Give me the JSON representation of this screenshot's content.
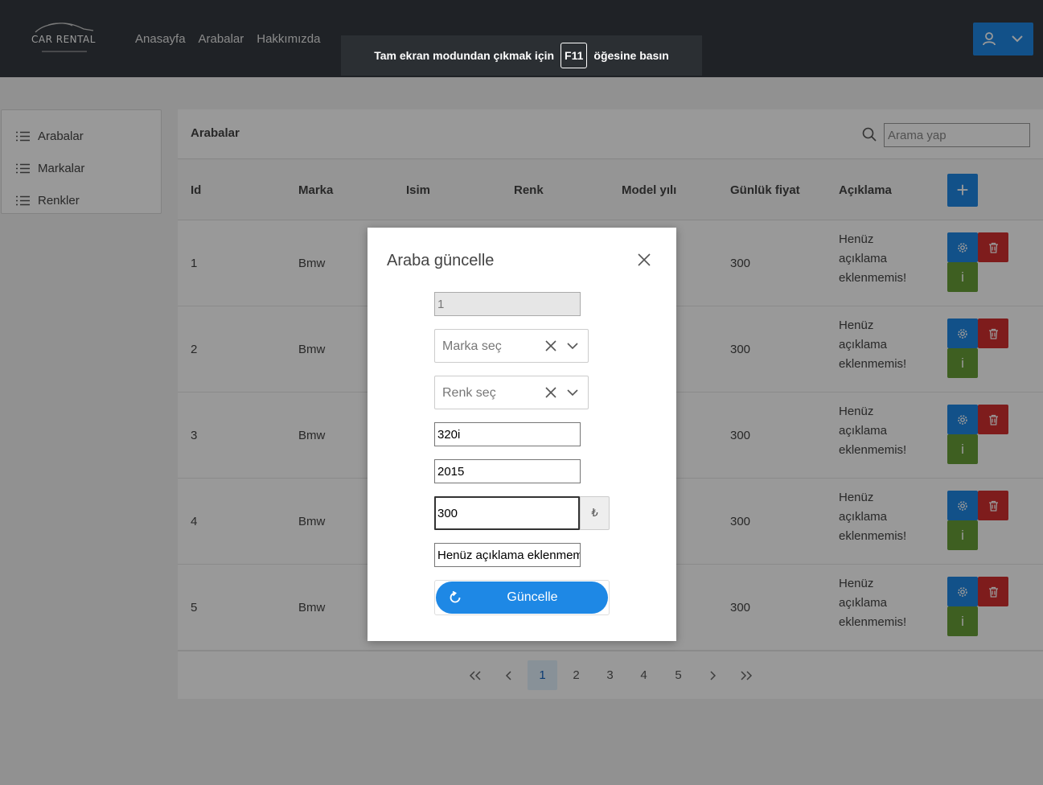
{
  "brand": {
    "logo_text": "CAR RENTAL"
  },
  "nav": {
    "items": [
      "Anasayfa",
      "Arabalar",
      "Hakkımızda"
    ]
  },
  "fullscreen_banner": {
    "before": "Tam ekran modundan çıkmak için",
    "key": "F11",
    "after": "öğesine basın"
  },
  "sidebar": {
    "items": [
      "Arabalar",
      "Markalar",
      "Renkler"
    ]
  },
  "table": {
    "title": "Arabalar",
    "search_placeholder": "Arama yap",
    "add_label": "+",
    "columns": [
      "Id",
      "Marka",
      "Isim",
      "Renk",
      "Model yılı",
      "Günlük fiyat",
      "Açıklama"
    ],
    "rows": [
      {
        "id": "1",
        "brand": "Bmw",
        "price": "300",
        "desc": [
          "Henüz",
          "açıklama",
          "eklenmemis!"
        ]
      },
      {
        "id": "2",
        "brand": "Bmw",
        "price": "300",
        "desc": [
          "Henüz",
          "açıklama",
          "eklenmemis!"
        ]
      },
      {
        "id": "3",
        "brand": "Bmw",
        "price": "300",
        "desc": [
          "Henüz",
          "açıklama",
          "eklenmemis!"
        ]
      },
      {
        "id": "4",
        "brand": "Bmw",
        "price": "300",
        "desc": [
          "Henüz",
          "açıklama",
          "eklenmemis!"
        ]
      },
      {
        "id": "5",
        "brand": "Bmw",
        "price": "300",
        "desc": [
          "Henüz",
          "açıklama",
          "eklenmemis!"
        ]
      }
    ],
    "info_label": "i"
  },
  "pagination": {
    "pages": [
      "1",
      "2",
      "3",
      "4",
      "5"
    ],
    "active": "1"
  },
  "modal": {
    "title": "Araba güncelle",
    "id_value": "1",
    "brand_placeholder": "Marka seç",
    "color_placeholder": "Renk seç",
    "name_value": "320i",
    "year_value": "2015",
    "price_value": "300",
    "currency": "₺",
    "description_value": "Henüz açıklama eklenmemis!",
    "update_label": "Güncelle"
  },
  "colors": {
    "primary": "#1e88e5",
    "danger": "#d32f2f",
    "success": "#689f38",
    "navbar": "#343a40"
  }
}
